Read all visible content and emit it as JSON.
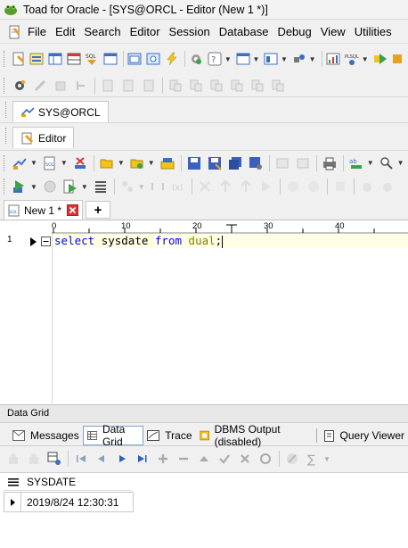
{
  "window": {
    "title": "Toad for Oracle - [SYS@ORCL - Editor (New 1 *)]"
  },
  "menu": [
    "File",
    "Edit",
    "Search",
    "Editor",
    "Session",
    "Database",
    "Debug",
    "View",
    "Utilities"
  ],
  "connection_tab": {
    "label": "SYS@ORCL"
  },
  "editor_tab": {
    "label": "Editor"
  },
  "doc_tab": {
    "label": "New 1 *",
    "add_label": "+"
  },
  "ruler": {
    "marks": [
      "0",
      "10",
      "20",
      "30",
      "40"
    ]
  },
  "editor": {
    "line_number": "1",
    "code": {
      "kw1": "select",
      "word2": "sysdate",
      "kw3": "from",
      "table": "dual",
      "end": ";"
    }
  },
  "bottom": {
    "panel_title": "Data Grid",
    "tabs": [
      "Messages",
      "Data Grid",
      "Trace",
      "DBMS Output (disabled)",
      "Query Viewer"
    ]
  },
  "grid": {
    "column_header": "SYSDATE",
    "rows": [
      {
        "value": "2019/8/24 12:30:31"
      }
    ]
  },
  "colors": {
    "keyword": "#0000ff",
    "table_name": "#808000",
    "current_line": "#ffffe6"
  }
}
